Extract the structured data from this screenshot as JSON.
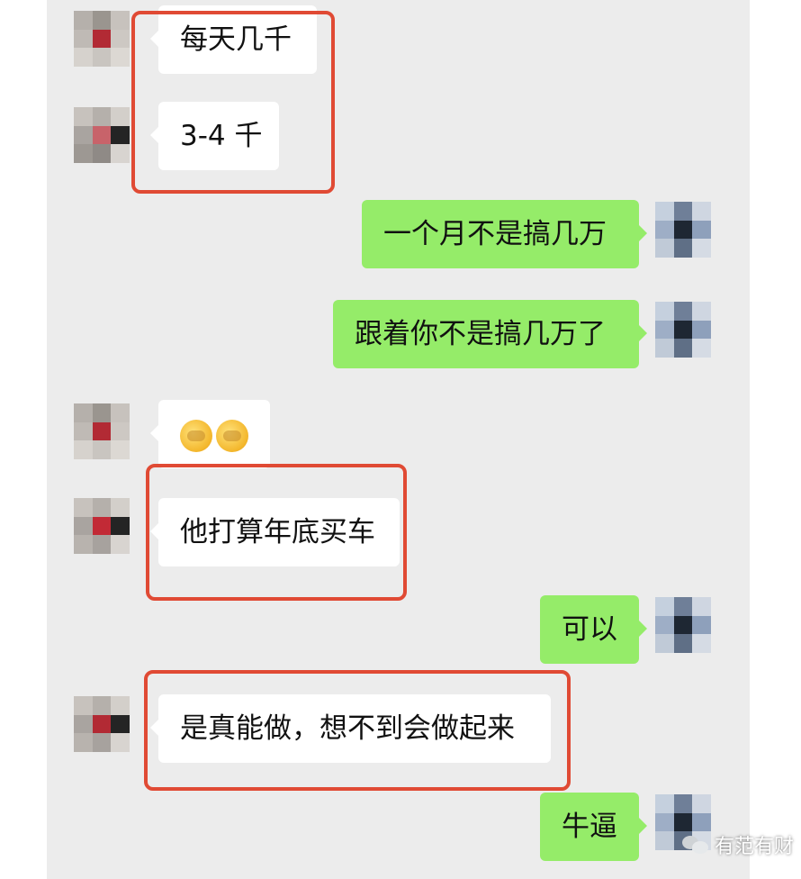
{
  "messages": [
    {
      "side": "in",
      "text": "每天几千"
    },
    {
      "side": "in",
      "text": "3-4 千"
    },
    {
      "side": "out",
      "text": "一个月不是搞几万"
    },
    {
      "side": "out",
      "text": "跟着你不是搞几万了"
    },
    {
      "side": "in",
      "emoji": [
        "facepalm-emoji",
        "facepalm-emoji"
      ]
    },
    {
      "side": "in",
      "text": "他打算年底买车"
    },
    {
      "side": "out",
      "text": "可以"
    },
    {
      "side": "in",
      "text": "是真能做，想不到会做起来"
    },
    {
      "side": "out",
      "text": "牛逼"
    }
  ],
  "watermark": {
    "text": "有范有财",
    "icon": "wechat-icon"
  },
  "colors": {
    "background": "#ececec",
    "incoming_bubble": "#ffffff",
    "outgoing_bubble": "#95ec69",
    "highlight": "#e04a34"
  }
}
